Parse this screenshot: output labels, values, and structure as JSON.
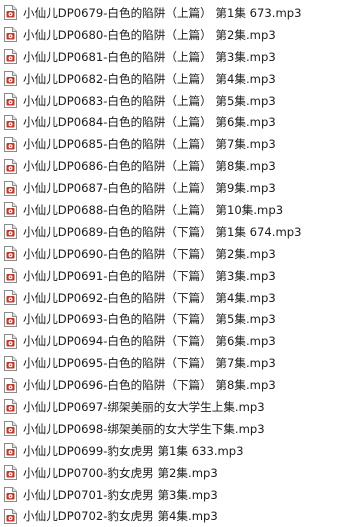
{
  "files": [
    {
      "name": "小仙儿DP0679-白色的陷阱（上篇） 第1集 673.mp3",
      "icon": "audio-file-icon"
    },
    {
      "name": "小仙儿DP0680-白色的陷阱（上篇） 第2集.mp3",
      "icon": "audio-file-icon"
    },
    {
      "name": "小仙儿DP0681-白色的陷阱（上篇） 第3集.mp3",
      "icon": "audio-file-icon"
    },
    {
      "name": "小仙儿DP0682-白色的陷阱（上篇） 第4集.mp3",
      "icon": "audio-file-icon"
    },
    {
      "name": "小仙儿DP0683-白色的陷阱（上篇） 第5集.mp3",
      "icon": "audio-file-icon"
    },
    {
      "name": "小仙儿DP0684-白色的陷阱（上篇） 第6集.mp3",
      "icon": "audio-file-icon"
    },
    {
      "name": "小仙儿DP0685-白色的陷阱（上篇） 第7集.mp3",
      "icon": "audio-file-icon"
    },
    {
      "name": "小仙儿DP0686-白色的陷阱（上篇） 第8集.mp3",
      "icon": "audio-file-icon"
    },
    {
      "name": "小仙儿DP0687-白色的陷阱（上篇） 第9集.mp3",
      "icon": "audio-file-icon"
    },
    {
      "name": "小仙儿DP0688-白色的陷阱（上篇） 第10集.mp3",
      "icon": "audio-file-icon"
    },
    {
      "name": "小仙儿DP0689-白色的陷阱（下篇） 第1集 674.mp3",
      "icon": "audio-file-icon"
    },
    {
      "name": "小仙儿DP0690-白色的陷阱（下篇） 第2集.mp3",
      "icon": "audio-file-icon"
    },
    {
      "name": "小仙儿DP0691-白色的陷阱（下篇） 第3集.mp3",
      "icon": "audio-file-icon"
    },
    {
      "name": "小仙儿DP0692-白色的陷阱（下篇） 第4集.mp3",
      "icon": "audio-file-icon"
    },
    {
      "name": "小仙儿DP0693-白色的陷阱（下篇） 第5集.mp3",
      "icon": "audio-file-icon"
    },
    {
      "name": "小仙儿DP0694-白色的陷阱（下篇） 第6集.mp3",
      "icon": "audio-file-icon"
    },
    {
      "name": "小仙儿DP0695-白色的陷阱（下篇） 第7集.mp3",
      "icon": "audio-file-icon"
    },
    {
      "name": "小仙儿DP0696-白色的陷阱（下篇） 第8集.mp3",
      "icon": "audio-file-icon"
    },
    {
      "name": "小仙儿DP0697-绑架美丽的女大学生上集.mp3",
      "icon": "audio-file-icon"
    },
    {
      "name": "小仙儿DP0698-绑架美丽的女大学生下集.mp3",
      "icon": "audio-file-icon"
    },
    {
      "name": "小仙儿DP0699-豹女虎男 第1集 633.mp3",
      "icon": "audio-file-icon"
    },
    {
      "name": "小仙儿DP0700-豹女虎男 第2集.mp3",
      "icon": "audio-file-icon"
    },
    {
      "name": "小仙儿DP0701-豹女虎男 第3集.mp3",
      "icon": "audio-file-icon"
    },
    {
      "name": "小仙儿DP0702-豹女虎男 第4集.mp3",
      "icon": "audio-file-icon"
    }
  ],
  "colors": {
    "text": "#1b1b1b",
    "icon_accent": "#c0392b",
    "icon_border": "#8a8a8a"
  }
}
